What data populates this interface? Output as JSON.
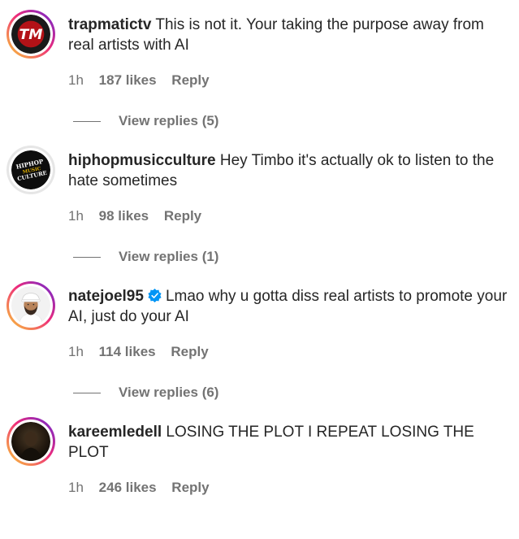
{
  "comments": [
    {
      "username": "trapmatictv",
      "verified": false,
      "text": "This is not it. Your taking the purpose away from real artists with AI",
      "time": "1h",
      "likes": "187 likes",
      "reply_label": "Reply",
      "view_replies": "View replies (5)",
      "avatar_icon": "trapmatic-tm-logo",
      "avatar_text": "TM",
      "ring": "gradient"
    },
    {
      "username": "hiphopmusicculture",
      "verified": false,
      "text": "Hey Timbo it's actually ok to listen to the hate sometimes",
      "time": "1h",
      "likes": "98 likes",
      "reply_label": "Reply",
      "view_replies": "View replies (1)",
      "avatar_icon": "hiphop-music-culture-logo",
      "avatar_text": "HIPHOP MUSIC CULTURE",
      "ring": "plain"
    },
    {
      "username": "natejoel95",
      "verified": true,
      "text": "Lmao why u gotta diss real artists to promote your AI, just do your AI",
      "time": "1h",
      "likes": "114 likes",
      "reply_label": "Reply",
      "view_replies": "View replies (6)",
      "avatar_icon": "person-with-cap-avatar",
      "ring": "gradient"
    },
    {
      "username": "kareemledell",
      "verified": false,
      "text": "LOSING THE PLOT I REPEAT LOSING THE PLOT",
      "time": "1h",
      "likes": "246 likes",
      "reply_label": "Reply",
      "avatar_icon": "person-dark-photo-avatar",
      "ring": "gradient"
    }
  ],
  "colors": {
    "text": "#262626",
    "secondary": "#737373",
    "verified_blue": "#0095f6",
    "story_ring_start": "#f9ce34",
    "story_ring_mid": "#ee2a7b",
    "story_ring_end": "#6228d7"
  }
}
